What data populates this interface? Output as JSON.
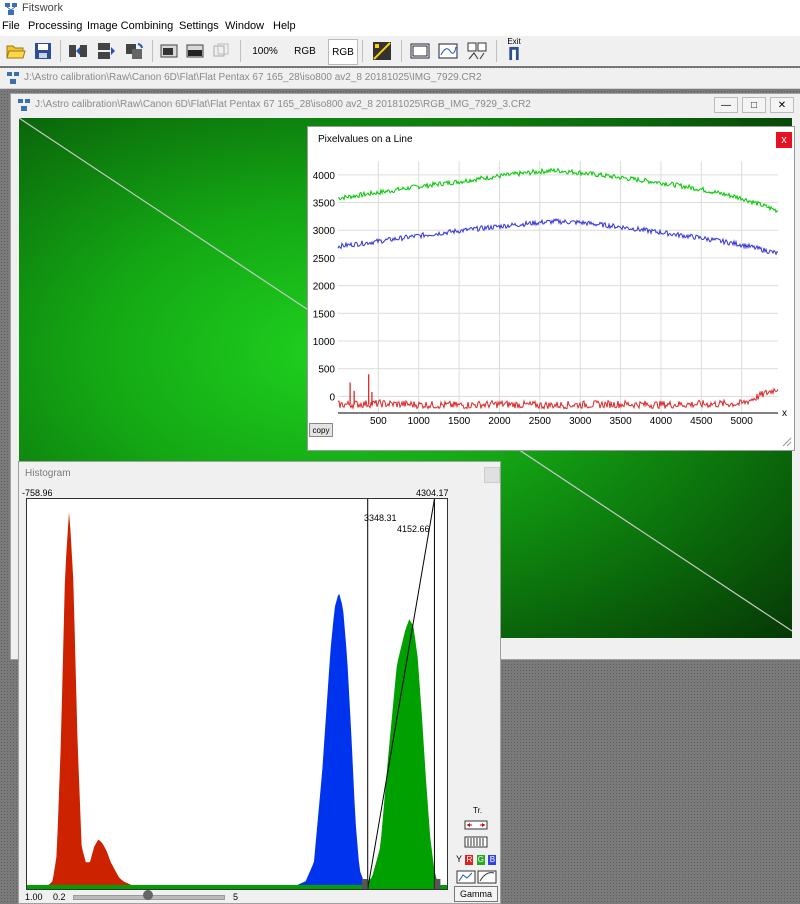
{
  "app": {
    "title": "Fitswork"
  },
  "menu": [
    "File",
    "Processing",
    "Image Combining",
    "Settings",
    "Window",
    "Help"
  ],
  "toolbar": {
    "zoom": "100%",
    "rgb1": "RGB",
    "rgb2": "RGB",
    "exit": "Exit"
  },
  "mdi_title": "J:\\Astro calibration\\Raw\\Canon 6D\\Flat\\Flat Pentax 67 165_28\\iso800 av2_8 20181025\\IMG_7929.CR2",
  "image_window": {
    "title": "J:\\Astro calibration\\Raw\\Canon 6D\\Flat\\Flat Pentax 67 165_28\\iso800 av2_8 20181025\\RGB_IMG_7929_3.CR2"
  },
  "pixel_window": {
    "title": "Pixelvalues on a Line",
    "copy": "copy",
    "close": "x"
  },
  "histogram_window": {
    "title": "Histogram",
    "min": "-758.96",
    "max": "4304.17",
    "marker1": "3348.31",
    "marker2": "4152.66",
    "slider_left": "1.00",
    "slider_min": "0.2",
    "slider_max": "5",
    "slider_value": 1.0,
    "side_tr": "Tr.",
    "side_y": "Y",
    "side_r": "R",
    "side_g": "G",
    "side_b": "B",
    "gamma": "Gamma"
  },
  "chart_data": [
    {
      "type": "line",
      "title": "Pixelvalues on a Line",
      "xlabel": "x",
      "ylabel": "",
      "xlim": [
        0,
        5450
      ],
      "ylim": [
        -300,
        4250
      ],
      "xticks": [
        500,
        1000,
        1500,
        2000,
        2500,
        3000,
        3500,
        4000,
        4500,
        5000
      ],
      "xtick_labels": [
        "500",
        "1000",
        "1500",
        "2000",
        "2500",
        "3000",
        "3500",
        "4000",
        "4500",
        "5000"
      ],
      "yticks": [
        0,
        500,
        1000,
        1500,
        2000,
        2500,
        3000,
        3500,
        4000
      ],
      "ytick_labels": [
        "0",
        "500",
        "1000",
        "1500",
        "2000",
        "2500",
        "3000",
        "3500",
        "4000"
      ],
      "grid": true,
      "series": [
        {
          "color": "#00c800",
          "x": [
            0,
            500,
            1000,
            1500,
            2000,
            2500,
            2700,
            3000,
            3500,
            4000,
            4500,
            5000,
            5450
          ],
          "values": [
            3580,
            3680,
            3790,
            3880,
            3980,
            4060,
            4080,
            4040,
            3950,
            3860,
            3740,
            3580,
            3350
          ]
        },
        {
          "color": "#3232dc",
          "x": [
            0,
            500,
            1000,
            1500,
            2000,
            2500,
            2700,
            3000,
            3500,
            4000,
            4500,
            5000,
            5450
          ],
          "values": [
            2710,
            2800,
            2900,
            2990,
            3070,
            3140,
            3160,
            3140,
            3060,
            2960,
            2860,
            2740,
            2580
          ]
        },
        {
          "color": "#dc2828",
          "x": [
            0,
            500,
            1000,
            1500,
            2000,
            2500,
            3000,
            3500,
            4000,
            4500,
            5000,
            5450
          ],
          "values": [
            -150,
            -130,
            -150,
            -160,
            -140,
            -160,
            -150,
            -140,
            -150,
            -140,
            -130,
            150
          ]
        }
      ]
    },
    {
      "type": "area",
      "title": "Histogram",
      "xlim": [
        -758.96,
        4304.17
      ],
      "ylim": [
        0,
        1
      ],
      "series": [
        {
          "color": "#cc2200",
          "x": [
            -758.96,
            -500,
            -450,
            -400,
            -350,
            -300,
            -250,
            -200,
            -150,
            -100,
            -50,
            0,
            50,
            100,
            150,
            200,
            250,
            300,
            350,
            400,
            450,
            500,
            600,
            4304.17
          ],
          "values": [
            0,
            0,
            0.01,
            0.08,
            0.38,
            0.82,
            0.99,
            0.8,
            0.38,
            0.1,
            0.06,
            0.06,
            0.1,
            0.12,
            0.11,
            0.09,
            0.06,
            0.04,
            0.02,
            0.01,
            0.005,
            0,
            0,
            0
          ]
        },
        {
          "color": "#0033ee",
          "x": [
            -758.96,
            2500,
            2600,
            2700,
            2800,
            2900,
            2950,
            3000,
            3050,
            3100,
            3150,
            3200,
            3250,
            3300,
            3400,
            4304.17
          ],
          "values": [
            0,
            0,
            0.01,
            0.06,
            0.3,
            0.62,
            0.73,
            0.77,
            0.73,
            0.6,
            0.4,
            0.17,
            0.04,
            0.01,
            0,
            0
          ]
        },
        {
          "color": "#00a000",
          "x": [
            -758.96,
            3300,
            3400,
            3500,
            3600,
            3700,
            3800,
            3850,
            3900,
            3950,
            4000,
            4050,
            4100,
            4150,
            4200,
            4304.17
          ],
          "values": [
            0,
            0,
            0.02,
            0.1,
            0.35,
            0.58,
            0.67,
            0.7,
            0.68,
            0.6,
            0.45,
            0.28,
            0.13,
            0.04,
            0,
            0
          ]
        }
      ]
    }
  ]
}
